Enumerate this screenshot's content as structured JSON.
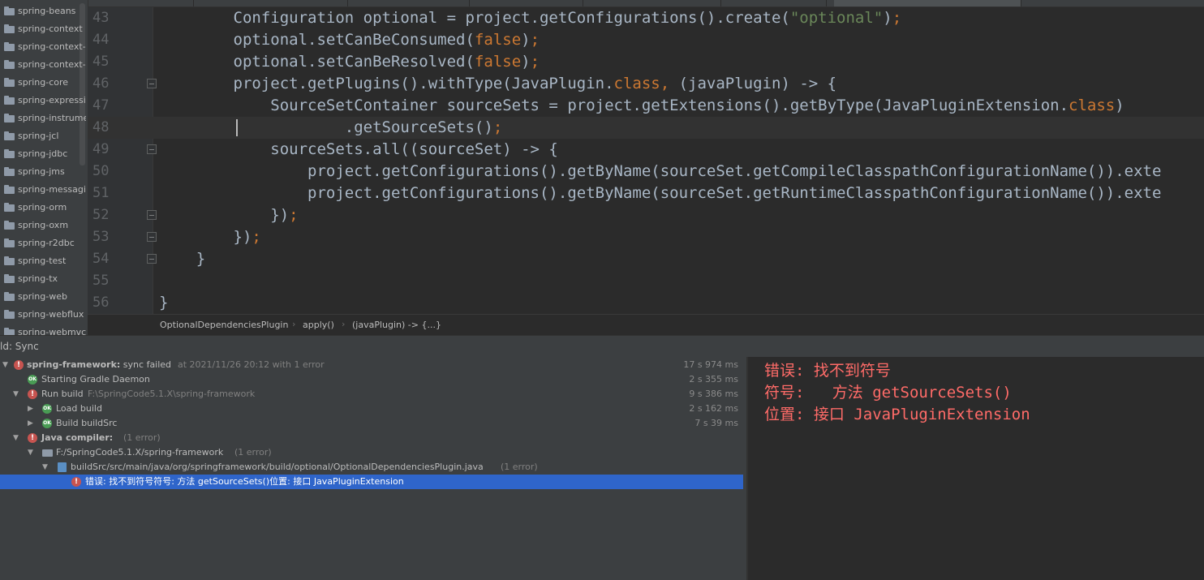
{
  "sidebar": {
    "items": [
      "spring-beans",
      "spring-context",
      "spring-context-",
      "spring-context-",
      "spring-core",
      "spring-expressi",
      "spring-instrume",
      "spring-jcl",
      "spring-jdbc",
      "spring-jms",
      "spring-messagin",
      "spring-orm",
      "spring-oxm",
      "spring-r2dbc",
      "spring-test",
      "spring-tx",
      "spring-web",
      "spring-webflux",
      "spring-webmvc"
    ]
  },
  "editor": {
    "lines": [
      {
        "num": "43",
        "code": "        Configuration optional = project.getConfigurations().create(\"optional\");"
      },
      {
        "num": "44",
        "code": "        optional.setCanBeConsumed(false);"
      },
      {
        "num": "45",
        "code": "        optional.setCanBeResolved(false);"
      },
      {
        "num": "46",
        "code": "        project.getPlugins().withType(JavaPlugin.class, (javaPlugin) -> {"
      },
      {
        "num": "47",
        "code": "            SourceSetContainer sourceSets = project.getExtensions().getByType(JavaPluginExtension.class)"
      },
      {
        "num": "48",
        "code": "                    .getSourceSets();"
      },
      {
        "num": "49",
        "code": "            sourceSets.all((sourceSet) -> {"
      },
      {
        "num": "50",
        "code": "                project.getConfigurations().getByName(sourceSet.getCompileClasspathConfigurationName()).exte"
      },
      {
        "num": "51",
        "code": "                project.getConfigurations().getByName(sourceSet.getRuntimeClasspathConfigurationName()).exte"
      },
      {
        "num": "52",
        "code": "            });"
      },
      {
        "num": "53",
        "code": "        });"
      },
      {
        "num": "54",
        "code": "    }"
      },
      {
        "num": "55",
        "code": ""
      },
      {
        "num": "56",
        "code": "}"
      }
    ]
  },
  "breadcrumb": {
    "items": [
      "OptionalDependenciesPlugin",
      "apply()",
      "(javaPlugin) -> {...}"
    ]
  },
  "tool_window": {
    "title": "ld: Sync"
  },
  "build": {
    "root": {
      "name": "spring-framework:",
      "status": " sync failed",
      "meta": "at 2021/11/26 20:12   with 1 error",
      "time": "17 s 974 ms"
    },
    "daemon": {
      "label": "Starting Gradle Daemon",
      "time": "2 s 355 ms"
    },
    "run_build": {
      "label": "Run build",
      "path": "F:\\SpringCode5.1.X\\spring-framework",
      "time": "9 s 386 ms"
    },
    "load_build": {
      "label": "Load build",
      "time": "2 s 162 ms"
    },
    "build_src": {
      "label": "Build buildSrc",
      "time": "7 s 39 ms"
    },
    "java_compiler": {
      "label": "Java compiler:",
      "count": "(1 error)"
    },
    "project_path": {
      "label": "F:/SpringCode5.1.X/spring-framework",
      "count": "(1 error)"
    },
    "file_path": {
      "label": "buildSrc/src/main/java/org/springframework/build/optional/OptionalDependenciesPlugin.java",
      "count": "(1 error)"
    },
    "error_row": {
      "label": "错误: 找不到符号符号:  方法 getSourceSets()位置: 接口 JavaPluginExtension"
    }
  },
  "message": {
    "line1": "错误: 找不到符号",
    "line2": "符号:   方法 getSourceSets()",
    "line3": "位置: 接口 JavaPluginExtension"
  }
}
